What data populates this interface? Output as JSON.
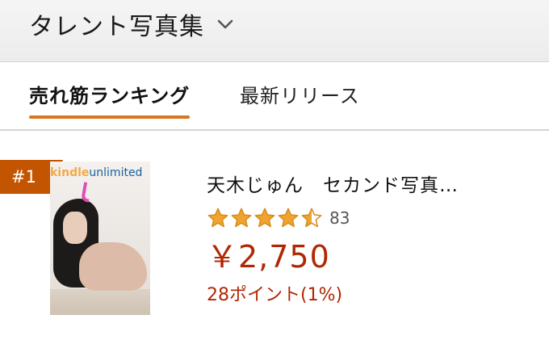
{
  "category": {
    "title": "タレント写真集",
    "dropdown_icon": "chevron-down-icon"
  },
  "tabs": [
    {
      "label": "売れ筋ランキング",
      "active": true
    },
    {
      "label": "最新リリース",
      "active": false
    }
  ],
  "product": {
    "rank": "#1",
    "cover_logo_kindle": "kindle",
    "cover_logo_unlimited": "unlimited",
    "title": "天木じゅん　セカンド写真…",
    "rating": 4.5,
    "rating_max": 5,
    "review_count": "83",
    "price": "￥2,750",
    "points": "28ポイント(1%)"
  },
  "colors": {
    "accent": "#d9761c",
    "rank_badge": "#c45500",
    "price": "#b12704",
    "star": "#f0a32e"
  }
}
